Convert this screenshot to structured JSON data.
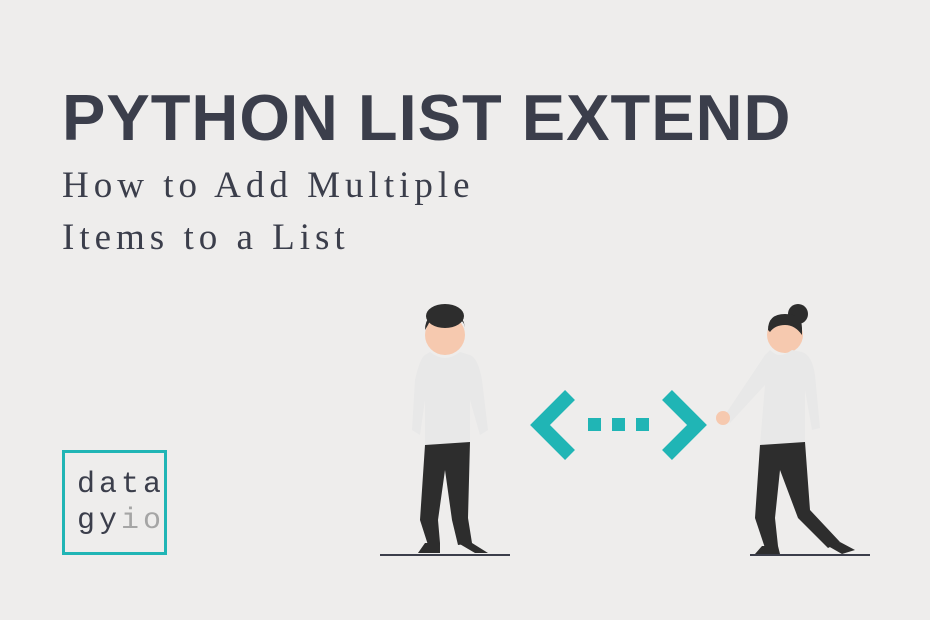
{
  "title": "Python List Extend",
  "subtitle_line1": "How to Add Multiple",
  "subtitle_line2": "Items to a List",
  "logo": {
    "line1": "data",
    "line2_dark": "gy",
    "line2_light": "io"
  },
  "colors": {
    "teal": "#20b5b5",
    "dark": "#3b3e4b",
    "background": "#eeedec",
    "light_gray": "#a5a5a5"
  }
}
